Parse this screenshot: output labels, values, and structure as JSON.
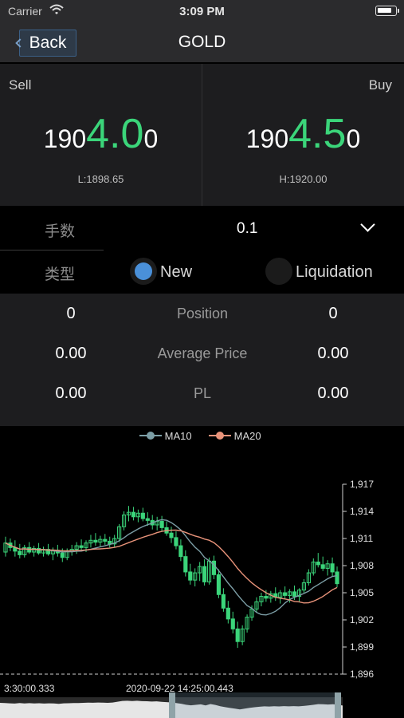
{
  "status": {
    "carrier": "Carrier",
    "time": "3:09 PM"
  },
  "nav": {
    "back": "Back",
    "title": "GOLD"
  },
  "quote": {
    "sell": {
      "label": "Sell",
      "pre": "190",
      "big": "4.0",
      "post": "0",
      "low": "L:1898.65"
    },
    "buy": {
      "label": "Buy",
      "pre": "190",
      "big": "4.5",
      "post": "0",
      "high": "H:1920.00"
    }
  },
  "order": {
    "lots_label": "手数",
    "lots_value": "0.1",
    "type_label": "类型",
    "types": [
      {
        "label": "New",
        "selected": true
      },
      {
        "label": "Liquidation",
        "selected": false
      }
    ]
  },
  "stats": [
    {
      "left": "0",
      "label": "Position",
      "right": "0"
    },
    {
      "left": "0.00",
      "label": "Average Price",
      "right": "0.00"
    },
    {
      "left": "0.00",
      "label": "PL",
      "right": "0.00"
    }
  ],
  "colors": {
    "up": "#3bd57a",
    "ma10": "#7c9ea6",
    "ma20": "#e9937a",
    "accent": "#4a90d9"
  },
  "chart_data": {
    "type": "candlestick",
    "legend": [
      "MA10",
      "MA20"
    ],
    "y_ticks": [
      "1,917",
      "1,914",
      "1,911",
      "1,908",
      "1,905",
      "1,902",
      "1,899",
      "1,896"
    ],
    "ylim": [
      1896,
      1917
    ],
    "x_labels": [
      "3:30:00.333",
      "2020-09-22 14:25:00.443"
    ],
    "candles": [
      [
        1909.5,
        1911.2,
        1909.0,
        1910.5
      ],
      [
        1910.5,
        1911.0,
        1909.6,
        1910.0
      ],
      [
        1910.0,
        1910.8,
        1909.0,
        1909.6
      ],
      [
        1909.6,
        1910.4,
        1908.8,
        1909.2
      ],
      [
        1909.2,
        1910.3,
        1908.9,
        1910.0
      ],
      [
        1910.0,
        1910.6,
        1909.3,
        1909.5
      ],
      [
        1909.5,
        1910.2,
        1909.0,
        1909.9
      ],
      [
        1909.9,
        1910.5,
        1909.2,
        1909.4
      ],
      [
        1909.4,
        1910.1,
        1909.0,
        1909.8
      ],
      [
        1909.8,
        1910.4,
        1909.1,
        1909.3
      ],
      [
        1909.3,
        1910.0,
        1908.6,
        1909.7
      ],
      [
        1909.7,
        1910.3,
        1909.0,
        1909.4
      ],
      [
        1909.4,
        1909.9,
        1908.4,
        1908.9
      ],
      [
        1908.9,
        1909.9,
        1908.6,
        1909.6
      ],
      [
        1909.6,
        1910.3,
        1909.1,
        1909.8
      ],
      [
        1909.8,
        1910.6,
        1909.3,
        1910.2
      ],
      [
        1910.2,
        1910.9,
        1909.6,
        1910.0
      ],
      [
        1910.0,
        1910.8,
        1909.5,
        1910.5
      ],
      [
        1910.5,
        1911.4,
        1910.0,
        1910.8
      ],
      [
        1910.8,
        1911.6,
        1910.2,
        1910.6
      ],
      [
        1910.6,
        1911.3,
        1910.1,
        1910.9
      ],
      [
        1910.9,
        1911.5,
        1910.3,
        1910.7
      ],
      [
        1910.7,
        1911.2,
        1910.0,
        1910.4
      ],
      [
        1910.4,
        1911.4,
        1910.0,
        1911.0
      ],
      [
        1911.0,
        1912.6,
        1910.6,
        1912.3
      ],
      [
        1912.3,
        1914.0,
        1911.9,
        1913.6
      ],
      [
        1913.6,
        1914.6,
        1912.9,
        1913.9
      ],
      [
        1913.9,
        1914.5,
        1913.0,
        1913.4
      ],
      [
        1913.4,
        1914.2,
        1912.8,
        1913.8
      ],
      [
        1913.8,
        1914.4,
        1912.9,
        1913.2
      ],
      [
        1913.2,
        1913.9,
        1912.4,
        1913.0
      ],
      [
        1913.0,
        1913.6,
        1912.0,
        1912.5
      ],
      [
        1912.5,
        1913.4,
        1911.9,
        1912.9
      ],
      [
        1912.9,
        1913.5,
        1911.8,
        1912.2
      ],
      [
        1912.2,
        1912.9,
        1911.3,
        1911.6
      ],
      [
        1911.6,
        1912.3,
        1910.5,
        1911.1
      ],
      [
        1911.1,
        1911.8,
        1909.8,
        1910.2
      ],
      [
        1910.2,
        1910.9,
        1908.5,
        1909.0
      ],
      [
        1909.0,
        1909.7,
        1906.8,
        1907.3
      ],
      [
        1907.3,
        1908.2,
        1905.9,
        1906.4
      ],
      [
        1906.4,
        1907.7,
        1905.7,
        1907.2
      ],
      [
        1907.2,
        1908.4,
        1906.3,
        1907.9
      ],
      [
        1907.9,
        1908.7,
        1905.8,
        1906.2
      ],
      [
        1906.2,
        1908.9,
        1905.9,
        1908.5
      ],
      [
        1908.5,
        1909.1,
        1906.5,
        1907.0
      ],
      [
        1907.0,
        1907.6,
        1904.4,
        1904.8
      ],
      [
        1904.8,
        1905.5,
        1902.9,
        1903.3
      ],
      [
        1903.3,
        1904.1,
        1901.6,
        1902.1
      ],
      [
        1902.1,
        1902.9,
        1900.5,
        1901.0
      ],
      [
        1901.0,
        1901.8,
        1898.9,
        1899.6
      ],
      [
        1899.6,
        1901.4,
        1899.2,
        1901.0
      ],
      [
        1901.0,
        1902.6,
        1900.6,
        1902.3
      ],
      [
        1902.3,
        1903.6,
        1901.9,
        1903.2
      ],
      [
        1903.2,
        1904.5,
        1902.8,
        1904.0
      ],
      [
        1904.0,
        1905.0,
        1903.5,
        1904.6
      ],
      [
        1904.6,
        1905.3,
        1904.0,
        1904.4
      ],
      [
        1904.4,
        1905.2,
        1903.9,
        1904.9
      ],
      [
        1904.9,
        1905.6,
        1904.1,
        1904.5
      ],
      [
        1904.5,
        1905.3,
        1903.8,
        1905.0
      ],
      [
        1905.0,
        1905.7,
        1904.3,
        1904.7
      ],
      [
        1904.7,
        1905.4,
        1903.9,
        1905.1
      ],
      [
        1905.1,
        1905.8,
        1904.2,
        1904.6
      ],
      [
        1904.6,
        1905.5,
        1904.0,
        1905.3
      ],
      [
        1905.3,
        1906.5,
        1905.0,
        1906.1
      ],
      [
        1906.1,
        1907.6,
        1905.8,
        1907.2
      ],
      [
        1907.2,
        1908.8,
        1906.9,
        1908.4
      ],
      [
        1908.4,
        1909.4,
        1907.8,
        1908.1
      ],
      [
        1908.1,
        1909.0,
        1907.4,
        1907.7
      ],
      [
        1907.7,
        1908.6,
        1906.9,
        1908.2
      ],
      [
        1908.2,
        1908.9,
        1906.8,
        1907.3
      ],
      [
        1907.3,
        1907.9,
        1905.6,
        1906.0
      ]
    ]
  }
}
